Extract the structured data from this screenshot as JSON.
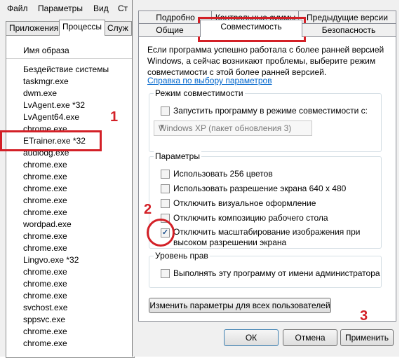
{
  "task_manager": {
    "menu": [
      "Файл",
      "Параметры",
      "Вид",
      "Ст"
    ],
    "tabs": [
      "Приложения",
      "Процессы",
      "Служ"
    ],
    "column_header": "Имя образа",
    "processes": [
      "Бездействие системы",
      "taskmgr.exe",
      "dwm.exe",
      "LvAgent.exe *32",
      "LvAgent64.exe",
      "chrome.exe",
      "ETrainer.exe *32",
      "audiodg.exe",
      "chrome.exe",
      "chrome.exe",
      "chrome.exe",
      "chrome.exe",
      "chrome.exe",
      "wordpad.exe",
      "chrome.exe",
      "chrome.exe",
      "Lingvo.exe *32",
      "chrome.exe",
      "chrome.exe",
      "chrome.exe",
      "svchost.exe",
      "sppsvc.exe",
      "chrome.exe",
      "chrome.exe"
    ]
  },
  "dialog": {
    "tabs_row1": [
      "Подробно",
      "Контрольные суммы",
      "Предыдущие версии"
    ],
    "tabs_row2": [
      "Общие",
      "Совместимость",
      "Безопасность"
    ],
    "intro": "Если программа успешно работала с более ранней версией Windows, а сейчас возникают проблемы, выберите режим совместимости с этой более ранней версией.",
    "help_link": "Справка по выбору параметров",
    "compat_group": {
      "title": "Режим совместимости",
      "run_in_compat": "Запустить программу в режиме совместимости с:",
      "os_select": "Windows XP (пакет обновления 3)"
    },
    "params_group": {
      "title": "Параметры",
      "options": [
        "Использовать 256 цветов",
        "Использовать разрешение экрана 640 x 480",
        "Отключить визуальное оформление",
        "Отключить композицию рабочего стола",
        "Отключить масштабирование изображения при высоком разрешении экрана"
      ]
    },
    "rights_group": {
      "title": "Уровень прав",
      "run_as_admin": "Выполнять эту программу от имени администратора"
    },
    "change_all_button": "Изменить параметры для всех пользователей",
    "ok_button": "ОК",
    "cancel_button": "Отмена",
    "apply_button": "Применить"
  },
  "annotations": [
    "1",
    "2",
    "3"
  ],
  "colors": {
    "annotation": "#d32027",
    "link": "#0066cc"
  }
}
